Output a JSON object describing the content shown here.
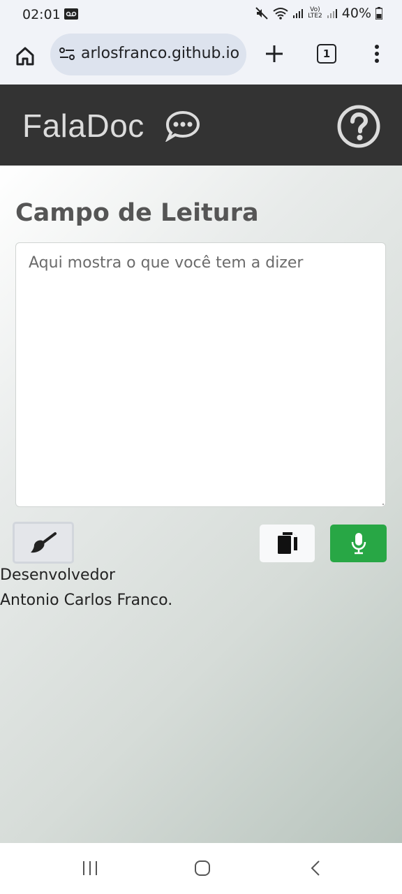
{
  "status_bar": {
    "time": "02:01",
    "battery": "40%"
  },
  "browser": {
    "url": "arlosfranco.github.io",
    "tab_count": "1"
  },
  "app": {
    "title": "FalaDoc"
  },
  "main": {
    "section_title": "Campo de Leitura",
    "textarea": {
      "value": "",
      "placeholder": "Aqui mostra o que você tem a dizer"
    }
  },
  "footer": {
    "developer_label": "Desenvolvedor",
    "developer_name": "Antonio Carlos Franco."
  },
  "colors": {
    "header_bg": "#333333",
    "mic_button": "#28a745",
    "copy_button": "#f8f9fa",
    "clear_button": "#e4e6ea"
  },
  "icons": [
    "voicemail-icon",
    "mute-icon",
    "wifi-icon",
    "signal-icon",
    "volte-icon",
    "battery-icon",
    "home-icon",
    "site-settings-icon",
    "plus-icon",
    "more-vert-icon",
    "chat-icon",
    "help-icon",
    "broom-icon",
    "copy-icon",
    "microphone-icon",
    "recent-apps-icon",
    "nav-home-icon",
    "back-icon"
  ]
}
